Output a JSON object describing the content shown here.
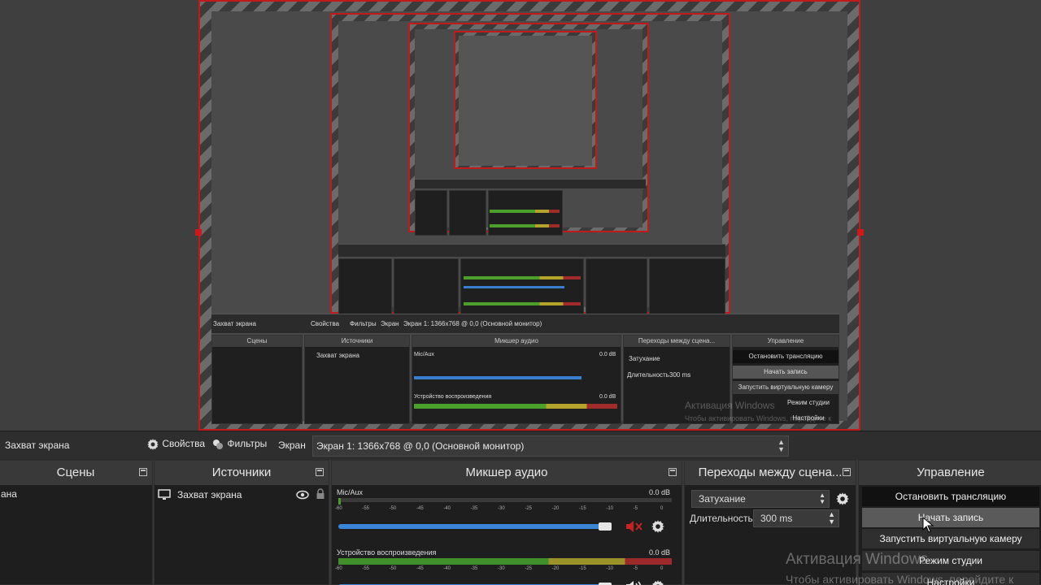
{
  "colors": {
    "accent_red": "#c21a1a",
    "volume_blue": "#3a85d8",
    "meter_green": "#3f8f2a",
    "meter_yellow": "#9c922a",
    "meter_red": "#9c2a2a"
  },
  "toolbar": {
    "source_name": "Захват экрана",
    "properties_label": "Свойства",
    "filters_label": "Фильтры",
    "screen_label": "Экран",
    "screen_value": "Экран 1: 1366x768 @ 0,0 (Основной монитор)"
  },
  "scenes": {
    "title": "Сцены",
    "items": [
      "ана"
    ]
  },
  "sources": {
    "title": "Источники",
    "items": [
      {
        "name": "Захват экрана"
      }
    ]
  },
  "mixer": {
    "title": "Микшер аудио",
    "ticks": [
      "-60",
      "-55",
      "-50",
      "-45",
      "-40",
      "-35",
      "-30",
      "-25",
      "-20",
      "-15",
      "-10",
      "-5",
      "0"
    ],
    "channels": [
      {
        "name": "Mic/Aux",
        "db": "0.0 dB",
        "level": 0.0,
        "volume": 1.0,
        "muted": true
      },
      {
        "name": "Устройство воспроизведения",
        "db": "0.0 dB",
        "level": 1.0,
        "volume": 1.0,
        "muted": false
      }
    ]
  },
  "transitions": {
    "title": "Переходы между сцена...",
    "selected": "Затухание",
    "duration_label": "Длительность",
    "duration_value": "300 ms"
  },
  "controls": {
    "title": "Управление",
    "stop_stream": "Остановить трансляцию",
    "start_record": "Начать запись",
    "virtual_cam": "Запустить виртуальную камеру",
    "studio_mode": "Режим студии",
    "settings": "Настройки"
  },
  "watermark": {
    "line1": "Активация Windows",
    "line2": "Чтобы активировать Windows, перейдите к"
  },
  "preview_mini": {
    "toolbar_source": "Захват экрана",
    "properties": "Свойства",
    "filters": "Фильтры",
    "screen": "Экран",
    "screen_value": "Экран 1: 1366x768 @ 0,0 (Основной монитор)",
    "scenes": "Сцены",
    "sources": "Источники",
    "source_item": "Захват экрана",
    "mixer": "Микшер аудио",
    "mic": "Mic/Aux",
    "playback": "Устройство воспроизведения",
    "db": "0.0 dB",
    "transitions": "Переходы между сцена...",
    "fade": "Затухание",
    "duration": "Длительность",
    "duration_value": "300 ms",
    "controls": "Управление",
    "stop_stream": "Остановить трансляцию",
    "start_record": "Начать запись",
    "virtual_cam": "Запустить виртуальную камеру",
    "studio_mode": "Режим студии",
    "settings": "Настройки",
    "wm1": "Активация Windows",
    "wm2": "Чтобы активировать Windows, перейдите к"
  }
}
